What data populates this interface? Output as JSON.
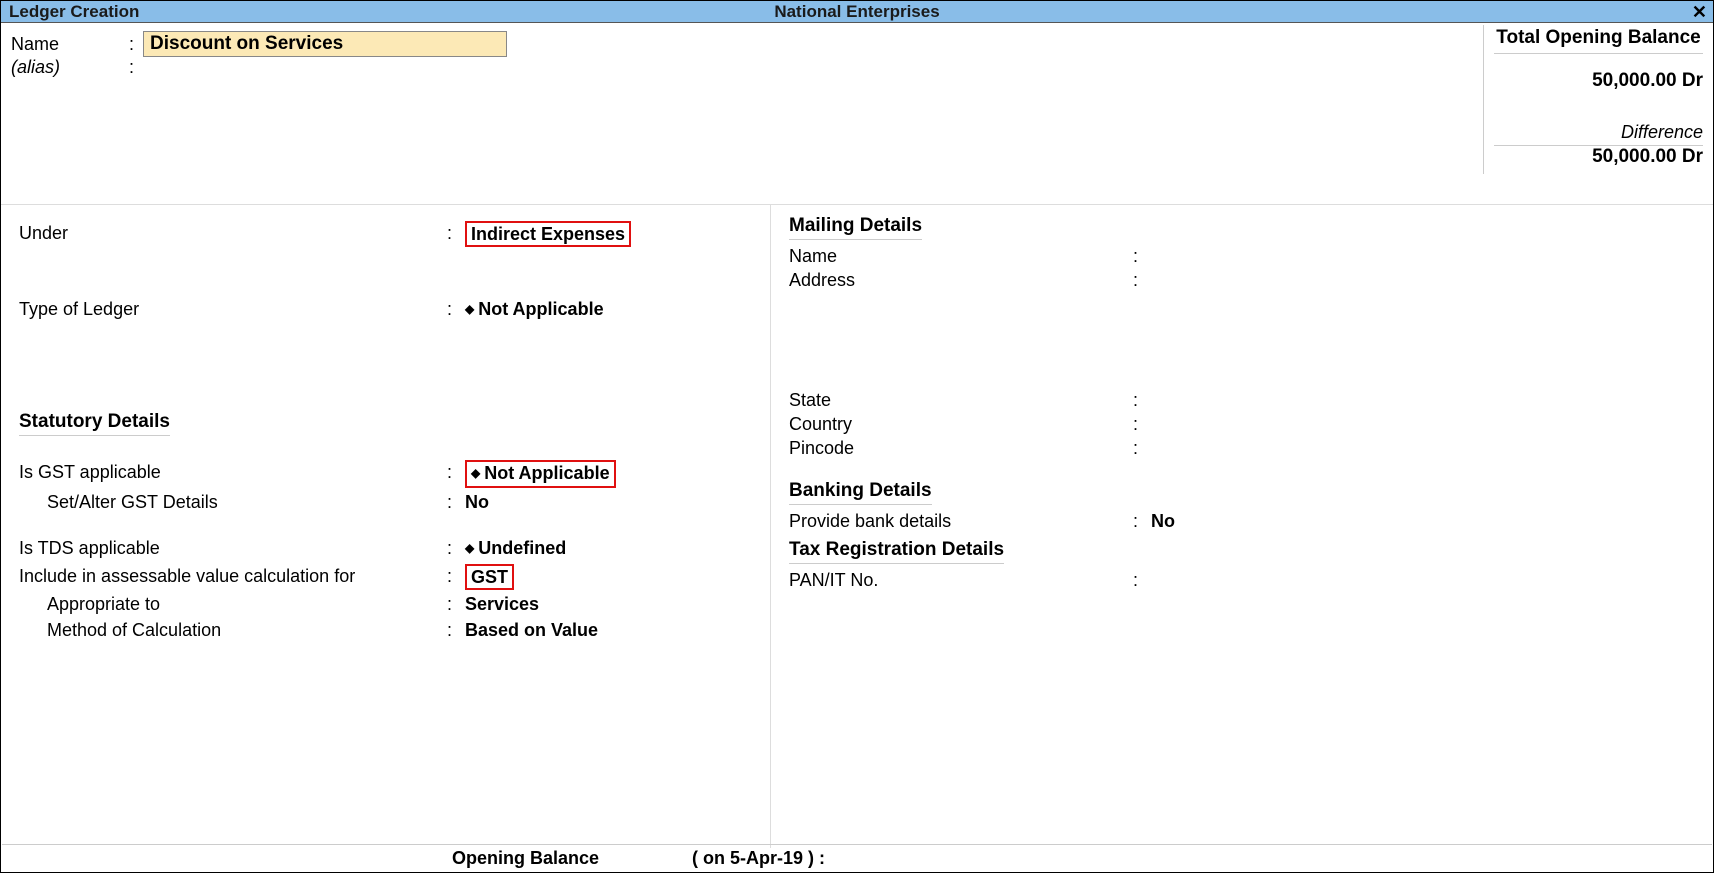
{
  "titlebar": {
    "left": "Ledger Creation",
    "center": "National Enterprises"
  },
  "top": {
    "name_label": "Name",
    "name_value": "Discount on Services",
    "alias_label": "(alias)",
    "alias_value": ""
  },
  "opening_panel": {
    "header": "Total Opening Balance",
    "amount": "50,000.00 Dr",
    "diff_label": "Difference",
    "diff_amount": "50,000.00 Dr"
  },
  "left": {
    "under_label": "Under",
    "under_value": "Indirect Expenses",
    "type_label": "Type of Ledger",
    "type_value": "Not Applicable",
    "stat_header": "Statutory Details",
    "gst_app_label": "Is GST applicable",
    "gst_app_value": "Not Applicable",
    "gst_alter_label": "Set/Alter GST Details",
    "gst_alter_value": "No",
    "tds_label": "Is TDS applicable",
    "tds_value": "Undefined",
    "incl_label": "Include in assessable value calculation for",
    "incl_value": "GST",
    "appr_label": "Appropriate to",
    "appr_value": "Services",
    "method_label": "Method of Calculation",
    "method_value": "Based on Value"
  },
  "right": {
    "mailing_header": "Mailing Details",
    "mail_name_label": "Name",
    "mail_name_value": "",
    "mail_addr_label": "Address",
    "mail_addr_value": "",
    "state_label": "State",
    "state_value": "",
    "country_label": "Country",
    "country_value": "",
    "pincode_label": "Pincode",
    "pincode_value": "",
    "banking_header": "Banking Details",
    "bank_label": "Provide bank details",
    "bank_value": "No",
    "tax_header": "Tax Registration Details",
    "pan_label": "PAN/IT No.",
    "pan_value": ""
  },
  "footer": {
    "open_bal_label": "Opening Balance",
    "open_bal_date": "( on 5-Apr-19 )  :"
  }
}
